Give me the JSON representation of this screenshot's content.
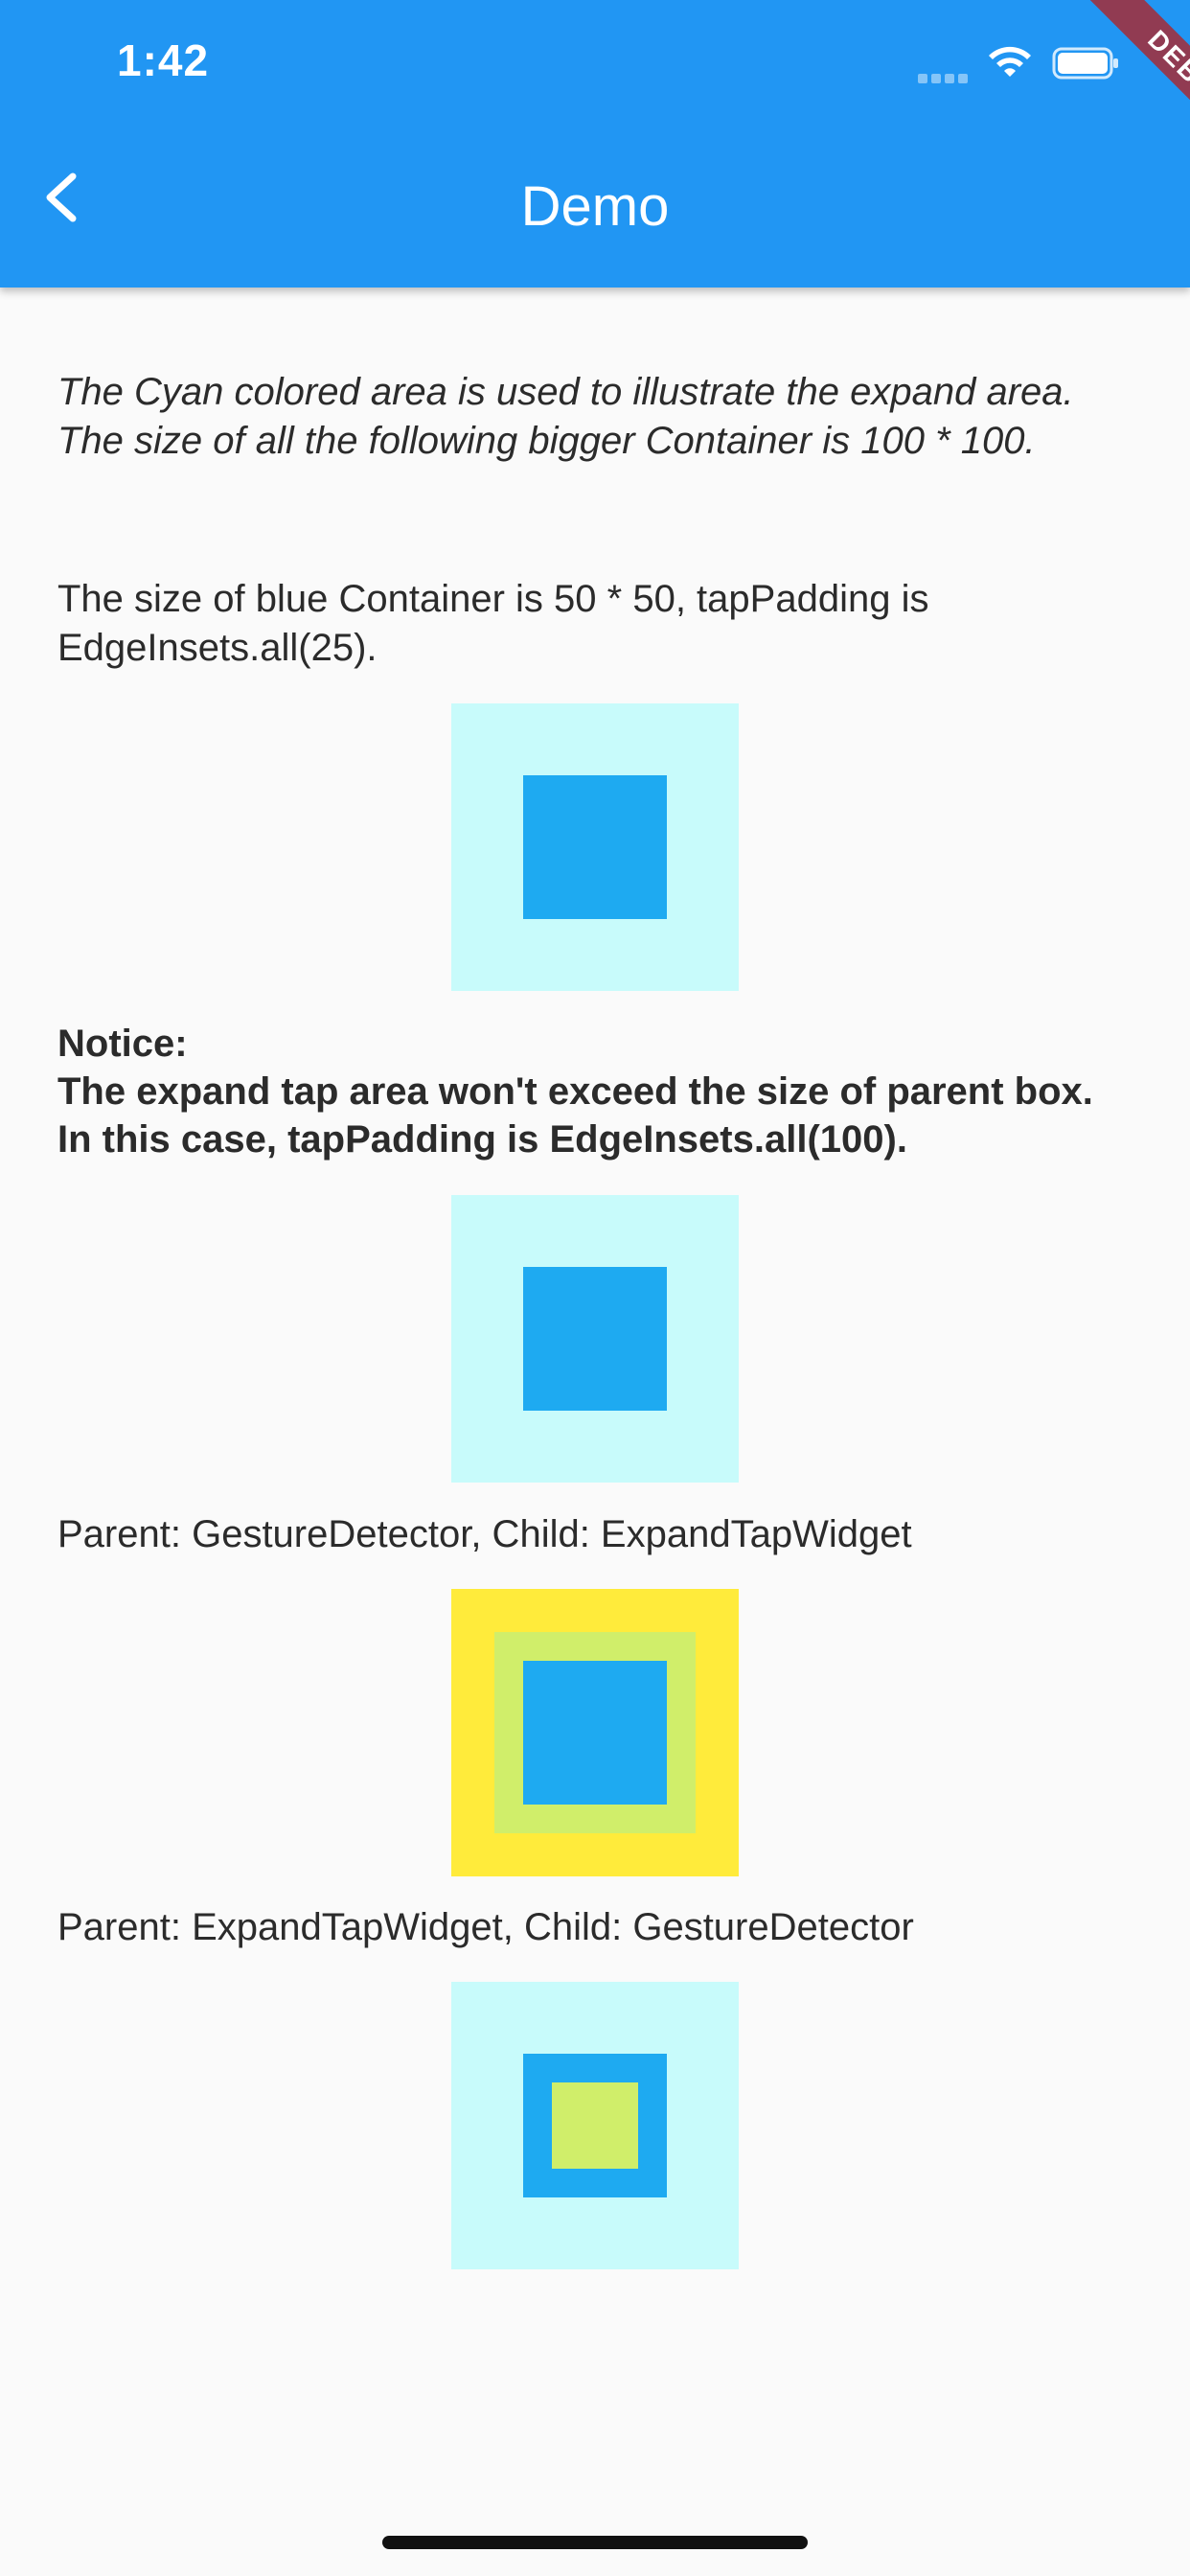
{
  "status_bar": {
    "time": "1:42"
  },
  "app_bar": {
    "title": "Demo",
    "back_icon": "chevron-left-icon"
  },
  "debug_banner": "DEBUG",
  "content": {
    "intro": "The Cyan colored area is used to illustrate the expand area. The size of all the following bigger Container is 100 * 100.",
    "blue_container_desc": "The size of blue Container is 50 * 50, tapPadding is EdgeInsets.all(25).",
    "notice_title": "Notice:",
    "notice_body": "The expand tap area won't exceed the size of parent box. In this case, tapPadding is EdgeInsets.all(100).",
    "case_gesture_parent": "Parent: GestureDetector, Child: ExpandTapWidget",
    "case_expand_parent": "Parent: ExpandTapWidget, Child: GestureDetector"
  },
  "colors": {
    "app_bar": "#2196f3",
    "cyan_area": "#c8fbfb",
    "blue": "#1eaaf1",
    "yellow": "#ffeb3b",
    "lime": "#d0ee6a"
  }
}
